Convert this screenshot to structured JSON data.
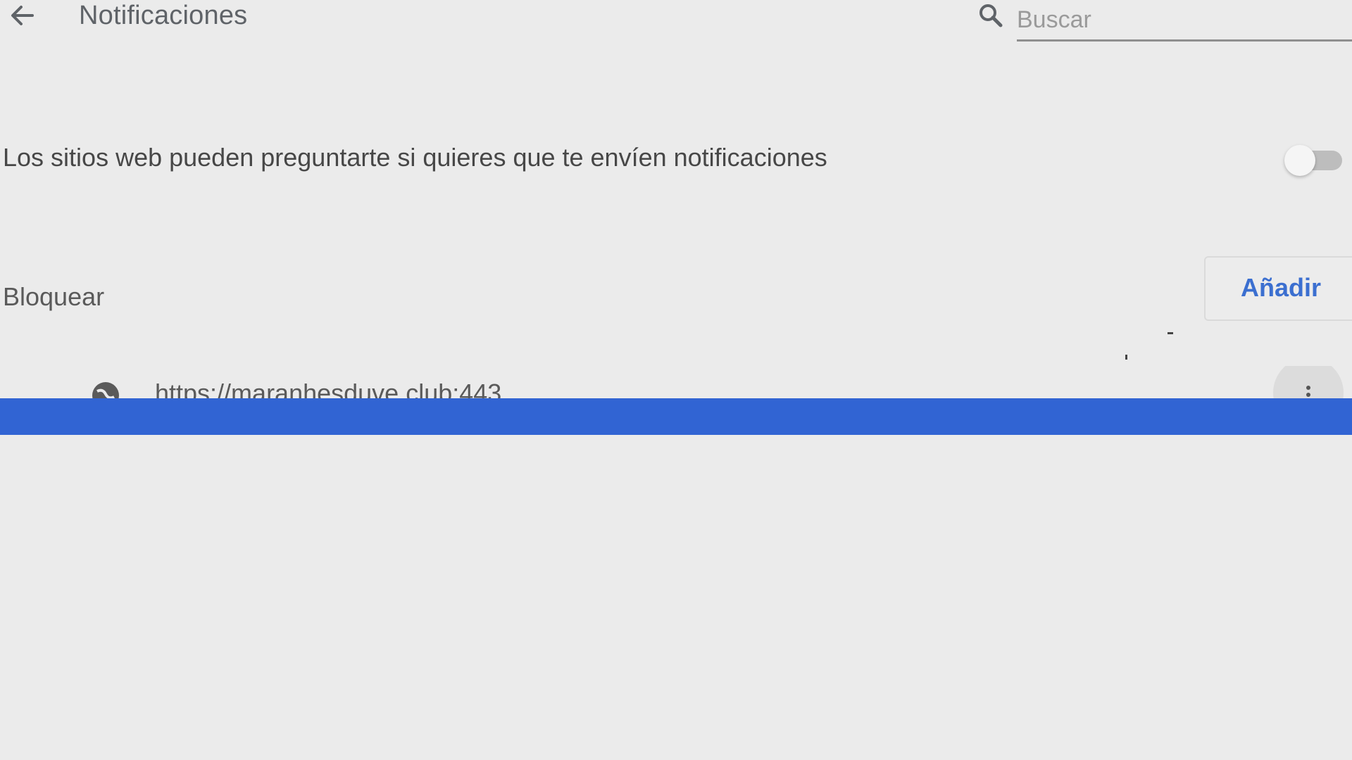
{
  "header": {
    "back_icon": "arrow-left-icon",
    "title": "Notificaciones",
    "search": {
      "icon": "search-icon",
      "placeholder": "Buscar",
      "value": ""
    }
  },
  "ask_setting": {
    "label": "Los sitios web pueden preguntarte si quieres que te envíen notificaciones",
    "enabled": false
  },
  "block_section": {
    "title": "Bloquear",
    "add_label": "Añadir",
    "sites": [
      {
        "icon": "globe-icon",
        "url": "https://maranhesduve.club:443",
        "menu_icon": "more-vertical-icon"
      }
    ]
  },
  "colors": {
    "background": "#ebebeb",
    "accent": "#3b6fd0",
    "overlay_bar": "#3164d3"
  }
}
